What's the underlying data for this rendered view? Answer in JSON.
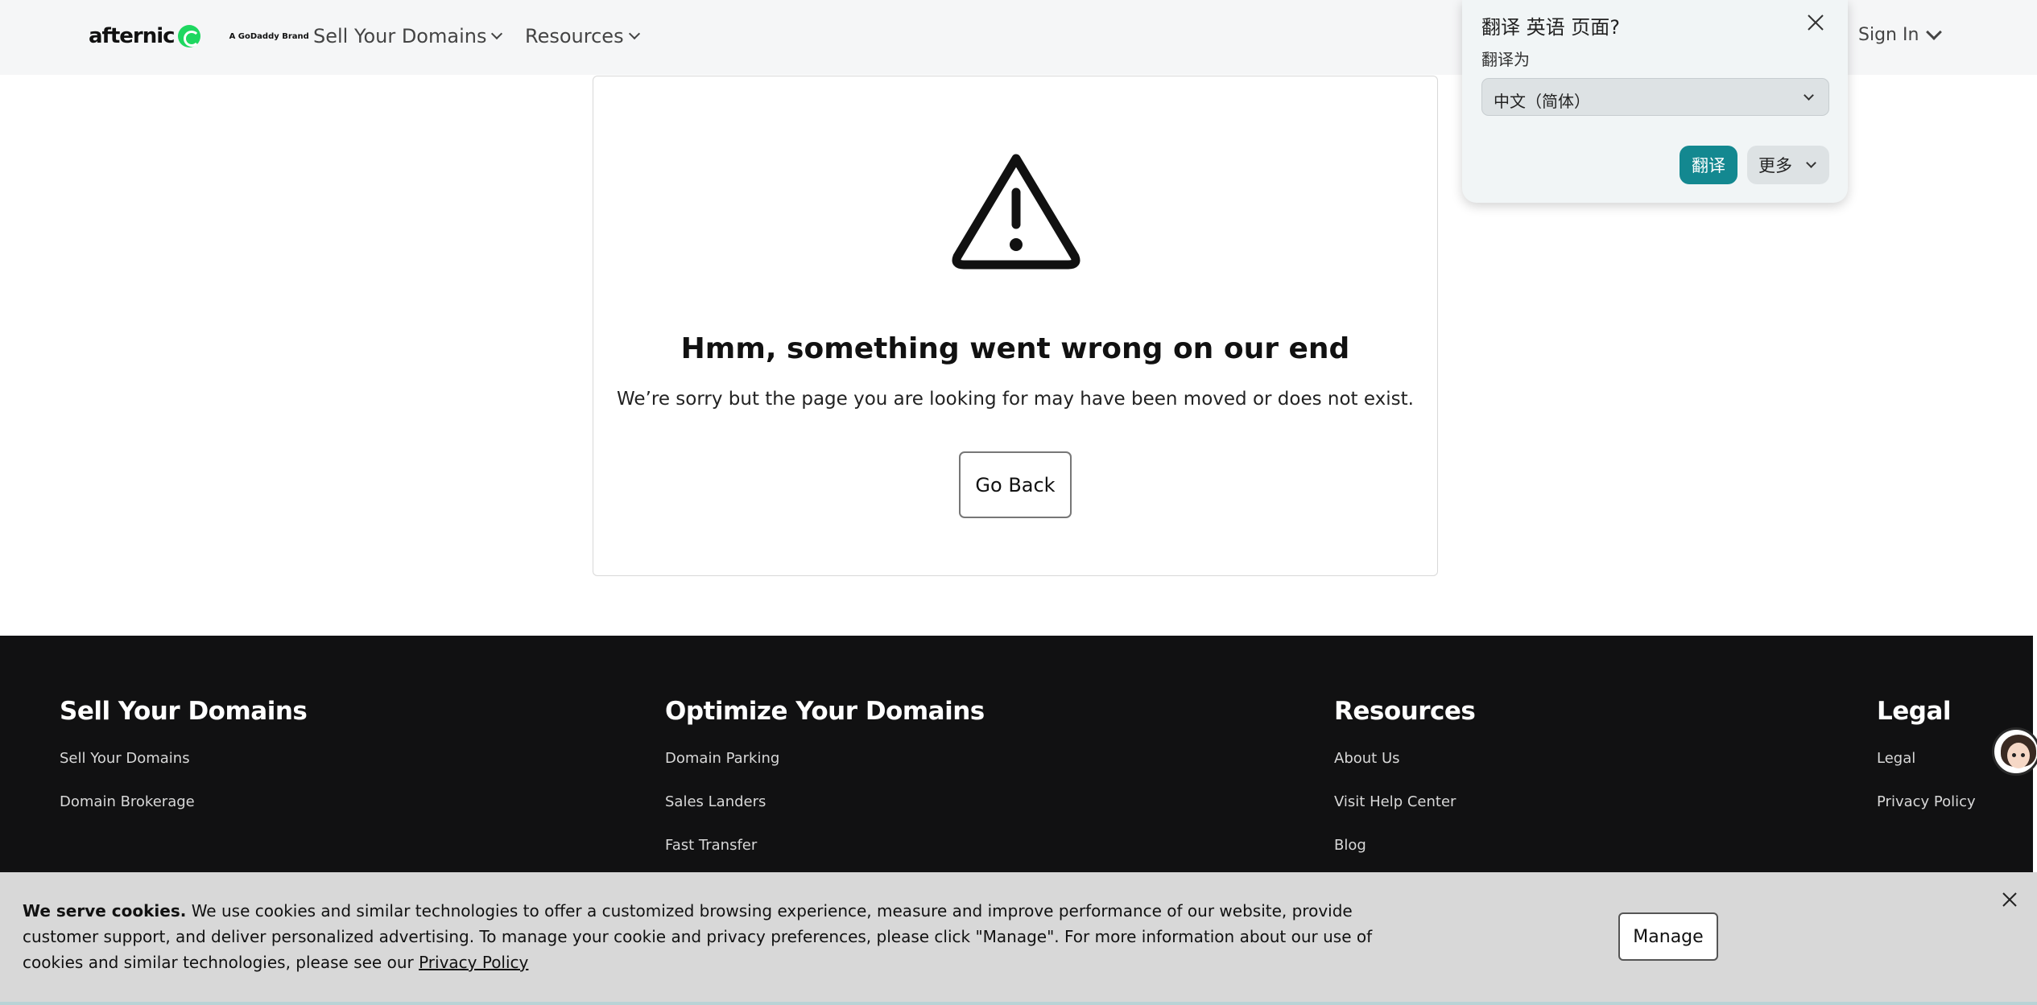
{
  "header": {
    "logo_text": "afternic",
    "brand_tag": "A GoDaddy Brand",
    "nav": {
      "sell_label": "Sell Your Domains",
      "resources_label": "Resources"
    },
    "sign_in_label": "Sign In"
  },
  "error": {
    "title": "Hmm, something went wrong on our end",
    "message": "We’re sorry but the page you are looking for may have been moved or does not exist.",
    "go_back_label": "Go Back"
  },
  "footer": {
    "columns": [
      {
        "heading": "Sell Your Domains",
        "links": [
          "Sell Your Domains",
          "Domain Brokerage"
        ]
      },
      {
        "heading": "Optimize Your Domains",
        "links": [
          "Domain Parking",
          "Sales Landers",
          "Fast Transfer"
        ]
      },
      {
        "heading": "Resources",
        "links": [
          "About Us",
          "Visit Help Center",
          "Blog"
        ]
      },
      {
        "heading": "Legal",
        "links": [
          "Legal",
          "Privacy Policy"
        ]
      }
    ]
  },
  "cookie": {
    "bold_lead": "We serve cookies.",
    "text": "We use cookies and similar technologies to offer a customized browsing experience, measure and improve performance of our website, provide customer support, and deliver personalized advertising. To manage your cookie and privacy preferences, please click \"Manage\". For more information about our use of cookies and similar technologies, please see our",
    "link_text": "Privacy Policy",
    "manage_label": "Manage"
  },
  "translate_popup": {
    "title": "翻译 英语 页面?",
    "label": "翻译为",
    "selected_language": "中文（简体）",
    "translate_label": "翻译",
    "more_label": "更多"
  },
  "colors": {
    "footer_bg": "#111112",
    "translate_button": "#138890",
    "logo_green": "#1ed760"
  }
}
